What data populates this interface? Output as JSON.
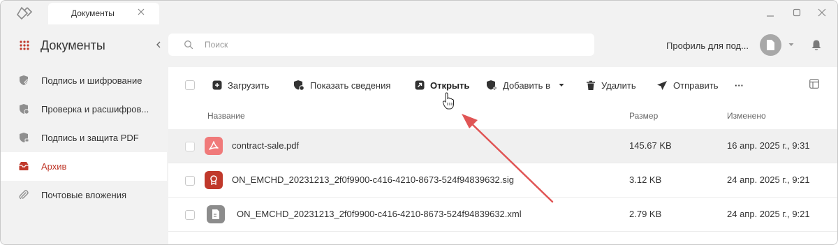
{
  "titlebar": {
    "tab_label": "Документы"
  },
  "sidebar": {
    "title": "Документы",
    "items": [
      {
        "label": "Подпись и шифрование",
        "icon": "shield-pen-icon",
        "active": false
      },
      {
        "label": "Проверка и расшифров...",
        "icon": "shield-check-icon",
        "active": false
      },
      {
        "label": "Подпись и защита PDF",
        "icon": "shield-lock-icon",
        "active": false
      },
      {
        "label": "Архив",
        "icon": "archive-icon",
        "active": true
      },
      {
        "label": "Почтовые вложения",
        "icon": "paperclip-icon",
        "active": false
      }
    ]
  },
  "search": {
    "placeholder": "Поиск"
  },
  "profile": {
    "name": "Профиль для под..."
  },
  "toolbar": {
    "upload": "Загрузить",
    "show_info": "Показать сведения",
    "open": "Открыть",
    "add_to": "Добавить в",
    "delete": "Удалить",
    "send": "Отправить",
    "more": "···"
  },
  "table": {
    "headers": {
      "name": "Название",
      "size": "Размер",
      "modified": "Изменено"
    },
    "rows": [
      {
        "name": "contract-sale.pdf",
        "size": "145.67 KB",
        "modified": "16 апр. 2025 г., 9:31",
        "icon": "pdf-icon",
        "selected": true
      },
      {
        "name": "ON_EMCHD_20231213_2f0f9900-c416-4210-8673-524f94839632.sig",
        "size": "3.12 KB",
        "modified": "24 апр. 2025 г., 9:21",
        "icon": "signature-file-icon",
        "selected": false
      },
      {
        "name": "ON_EMCHD_20231213_2f0f9900-c416-4210-8673-524f94839632.xml",
        "size": "2.79 KB",
        "modified": "24 апр. 2025 г., 9:21",
        "icon": "xml-file-icon",
        "selected": false
      }
    ]
  },
  "colors": {
    "accent": "#c0392b",
    "arrow": "#e05555",
    "pdf": "#f07a7a",
    "sig": "#c0392b",
    "xml": "#8c8c8c"
  }
}
